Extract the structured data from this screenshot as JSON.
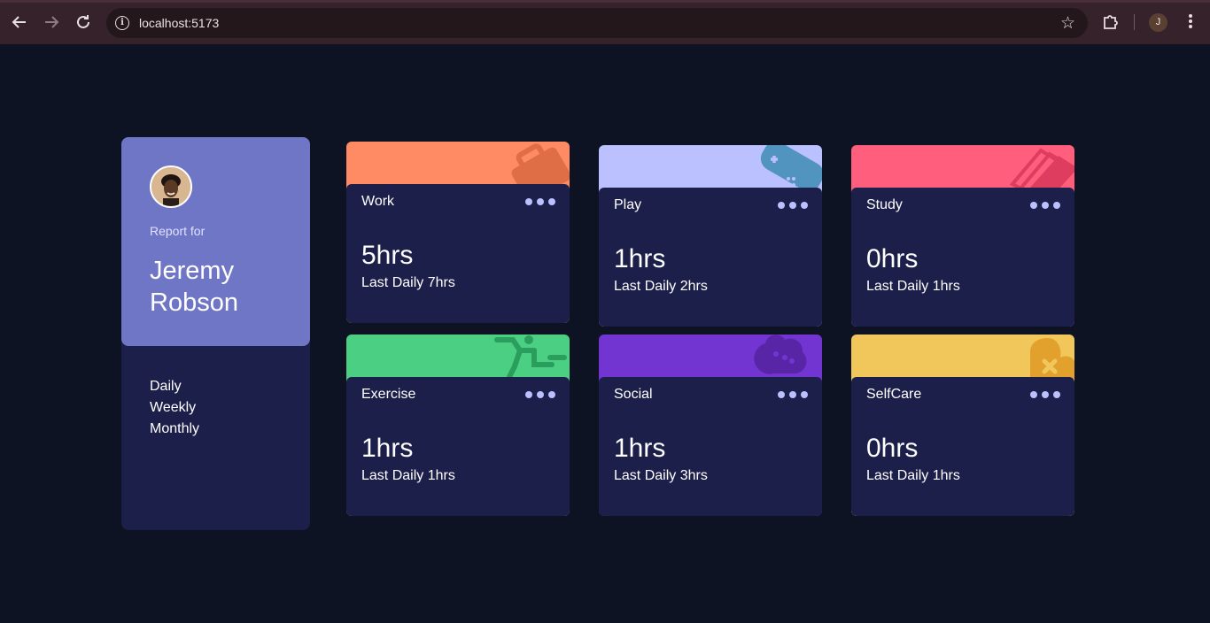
{
  "browser": {
    "url": "localhost:5173",
    "profile_initial": "J"
  },
  "profile": {
    "report_for": "Report for",
    "name": "Jeremy Robson",
    "periods": [
      "Daily",
      "Weekly",
      "Monthly"
    ]
  },
  "cards": [
    {
      "title": "Work",
      "hours": "5hrs",
      "previous": "Last Daily 7hrs",
      "color": "#ff8b64",
      "icon": "briefcase-icon"
    },
    {
      "title": "Play",
      "hours": "1hrs",
      "previous": "Last Daily 2hrs",
      "color": "#bbc0ff",
      "icon": "game-controller-icon"
    },
    {
      "title": "Study",
      "hours": "0hrs",
      "previous": "Last Daily 1hrs",
      "color": "#ff5e7d",
      "icon": "books-icon"
    },
    {
      "title": "Exercise",
      "hours": "1hrs",
      "previous": "Last Daily 1hrs",
      "color": "#4bcf82",
      "icon": "running-icon"
    },
    {
      "title": "Social",
      "hours": "1hrs",
      "previous": "Last Daily 3hrs",
      "color": "#7335d2",
      "icon": "chat-icon"
    },
    {
      "title": "SelfCare",
      "hours": "0hrs",
      "previous": "Last Daily 1hrs",
      "color": "#f1c75b",
      "icon": "heart-icon"
    }
  ]
}
